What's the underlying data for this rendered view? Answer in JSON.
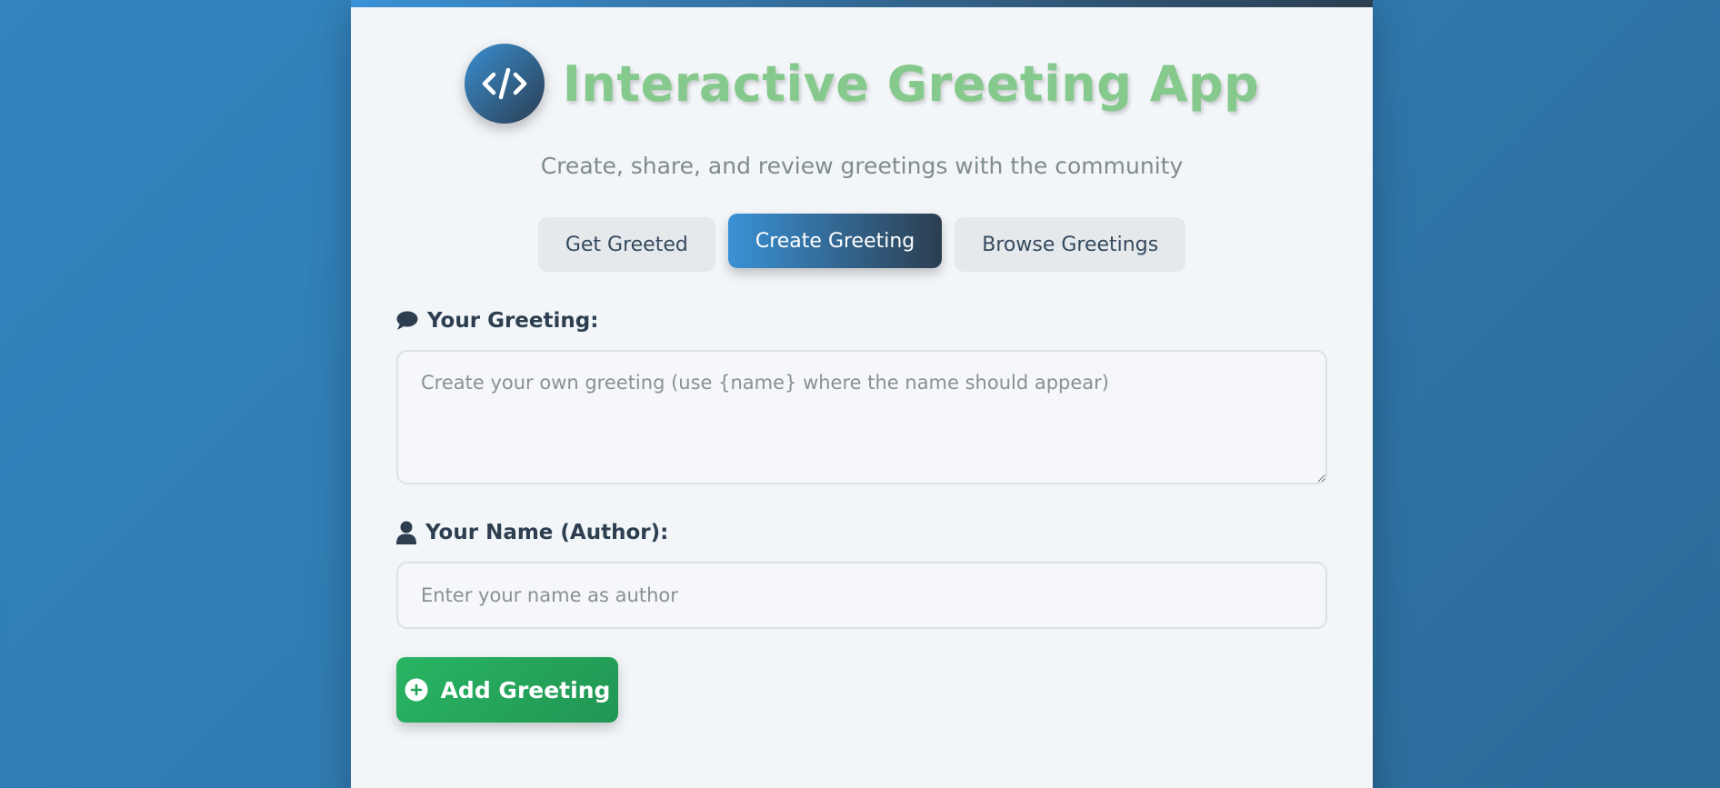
{
  "app": {
    "title": "Interactive Greeting App",
    "subtitle": "Create, share, and review greetings with the community",
    "logo_icon": "code-icon"
  },
  "tabs": [
    {
      "label": "Get Greeted",
      "active": false
    },
    {
      "label": "Create Greeting",
      "active": true
    },
    {
      "label": "Browse Greetings",
      "active": false
    }
  ],
  "form": {
    "greeting_label": "Your Greeting:",
    "greeting_icon": "comment-icon",
    "greeting_placeholder": "Create your own greeting (use {name} where the name should appear)",
    "greeting_value": "",
    "author_label": "Your Name (Author):",
    "author_icon": "user-icon",
    "author_placeholder": "Enter your name as author",
    "author_value": "",
    "submit_label": "Add Greeting",
    "submit_icon": "plus-circle-icon"
  },
  "colors": {
    "background": "#3385bf",
    "card": "#f3f6f9",
    "title": "#86c98d",
    "accent_start": "#3a92d6",
    "accent_end": "#2c3e50",
    "success": "#29b463"
  }
}
